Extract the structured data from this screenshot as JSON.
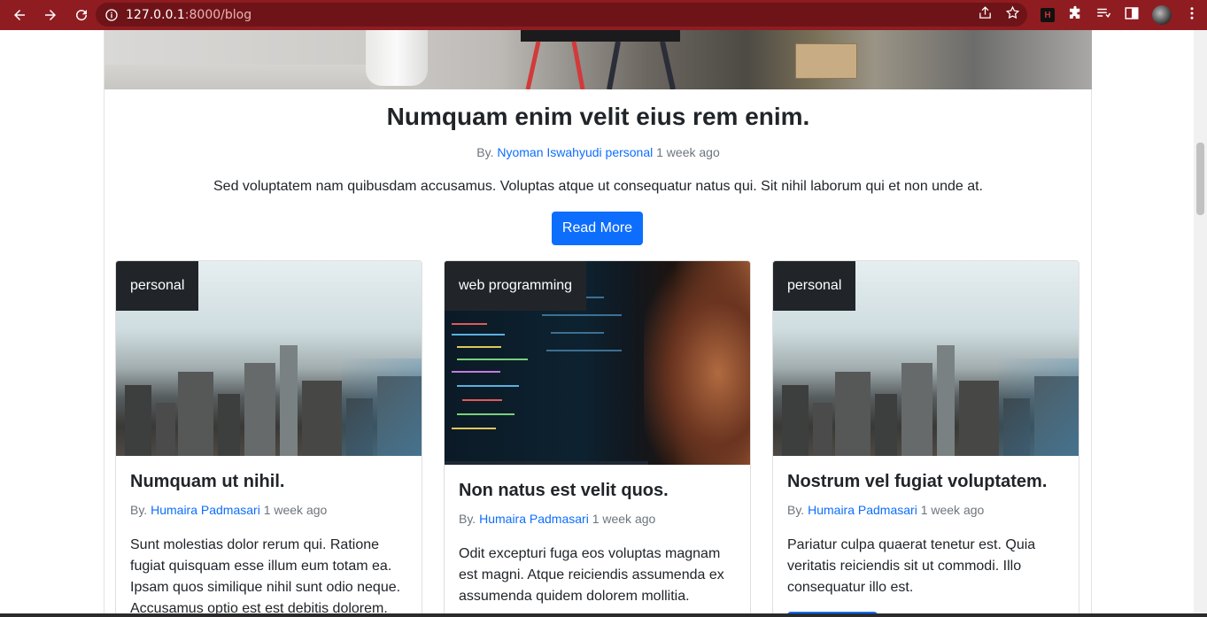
{
  "browser": {
    "url_host": "127.0.0.1",
    "url_rest": ":8000/blog",
    "icons": [
      "back-arrow-icon",
      "forward-arrow-icon",
      "reload-icon",
      "site-info-icon",
      "share-icon",
      "bookmark-star-icon",
      "extension-icon",
      "puzzle-icon",
      "reading-list-icon",
      "side-panel-icon",
      "profile-avatar",
      "kebab-menu-icon"
    ],
    "colors": {
      "toolbar": "#8f1c21",
      "omnibox": "#6e1418"
    }
  },
  "featured": {
    "title": "Numquam enim velit eius rem enim.",
    "meta_by": "By.",
    "author": "Nyoman Iswahyudi",
    "category": "personal",
    "time": "1 week ago",
    "excerpt": "Sed voluptatem nam quibusdam accusamus. Voluptas atque ut consequatur natus qui. Sit nihil laborum qui et non unde at.",
    "button": "Read More"
  },
  "cards": [
    {
      "category": "personal",
      "title": "Numquam ut nihil.",
      "meta_by": "By.",
      "author": "Humaira Padmasari",
      "time": "1 week ago",
      "excerpt": "Sunt molestias dolor rerum qui. Ratione fugiat quisquam esse illum eum totam ea. Ipsam quos similique nihil sunt odio neque. Accusamus optio est est debitis dolorem."
    },
    {
      "category": "web programming",
      "title": "Non natus est velit quos.",
      "meta_by": "By.",
      "author": "Humaira Padmasari",
      "time": "1 week ago",
      "excerpt": "Odit excepturi fuga eos voluptas magnam est magni. Atque reiciendis assumenda ex assumenda quidem dolorem mollitia."
    },
    {
      "category": "personal",
      "title": "Nostrum vel fugiat voluptatem.",
      "meta_by": "By.",
      "author": "Humaira Padmasari",
      "time": "1 week ago",
      "excerpt": "Pariatur culpa quaerat tenetur est. Quia veritatis reiciendis sit ut commodi. Illo consequatur illo est."
    }
  ],
  "colors": {
    "primary": "#0d6efd",
    "badge": "#212529",
    "muted": "#6c757d"
  }
}
